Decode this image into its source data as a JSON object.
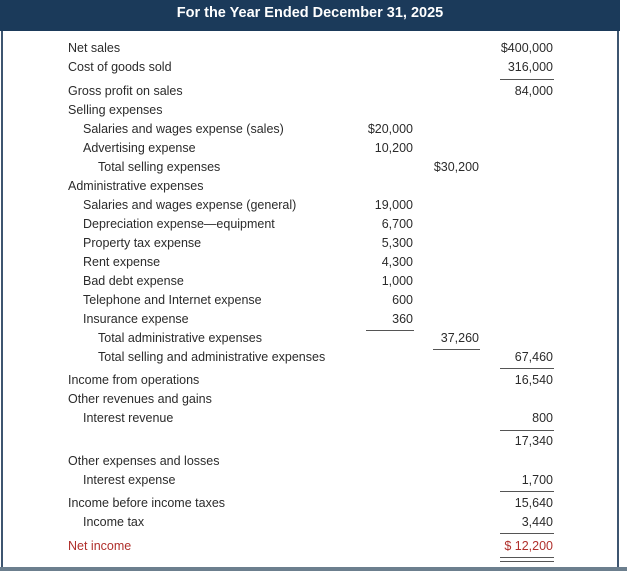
{
  "header": {
    "title": "For the Year Ended December 31, 2025"
  },
  "colors": {
    "header_bg": "#1b3a5a",
    "net_income": "#b0302c"
  },
  "statement": {
    "rows": [
      {
        "label": "Net sales",
        "c3": "$400,000"
      },
      {
        "label": "Cost of goods sold",
        "c3": "316,000"
      },
      {
        "label": "Gross profit on sales",
        "c3": "84,000"
      },
      {
        "label": "Selling expenses"
      },
      {
        "label": "Salaries and wages expense (sales)",
        "c1": "$20,000"
      },
      {
        "label": "Advertising expense",
        "c1": "10,200"
      },
      {
        "label": "Total selling expenses",
        "c2": "$30,200"
      },
      {
        "label": "Administrative expenses"
      },
      {
        "label": "Salaries and wages expense (general)",
        "c1": "19,000"
      },
      {
        "label": "Depreciation expense—equipment",
        "c1": "6,700"
      },
      {
        "label": "Property tax expense",
        "c1": "5,300"
      },
      {
        "label": "Rent expense",
        "c1": "4,300"
      },
      {
        "label": "Bad debt expense",
        "c1": "1,000"
      },
      {
        "label": "Telephone and Internet expense",
        "c1": "600"
      },
      {
        "label": "Insurance expense",
        "c1": "360"
      },
      {
        "label": "Total administrative expenses",
        "c2": "37,260"
      },
      {
        "label": "Total selling and administrative expenses",
        "c3": "67,460"
      },
      {
        "label": "Income from operations",
        "c3": "16,540"
      },
      {
        "label": "Other revenues and gains"
      },
      {
        "label": "Interest revenue",
        "c3": "800"
      },
      {
        "c3": "17,340"
      },
      {
        "label": "Other expenses and losses"
      },
      {
        "label": "Interest expense",
        "c3": "1,700"
      },
      {
        "label": "Income before income taxes",
        "c3": "15,640"
      },
      {
        "label": "Income tax",
        "c3": "3,440"
      },
      {
        "label": "Net income",
        "c3": "$ 12,200"
      }
    ]
  }
}
